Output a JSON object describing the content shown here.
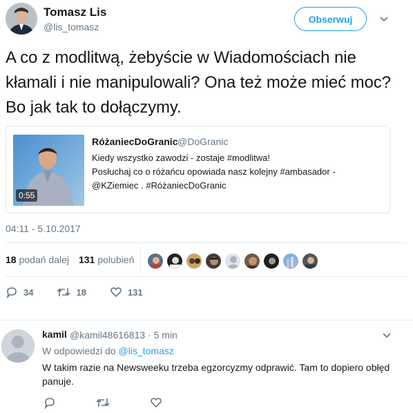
{
  "author": {
    "name": "Tomasz Lis",
    "handle": "@lis_tomasz",
    "follow_label": "Obserwuj"
  },
  "tweet": {
    "text": "A co z modlitwą, żebyście w Wiadomościach nie kłamali i nie manipulowali? Ona też może mieć moc? Bo jak tak to dołączymy.",
    "timestamp": "04:11 - 5.10.2017"
  },
  "quote": {
    "name": "RóżaniecDoGranic",
    "handle": "@DoGranic",
    "text_line1": "Kiedy wszystko zawodzi - zostaje #modlitwa!",
    "text_line2": "Posłuchaj co o różańcu opowiada nasz kolejny #ambasador -",
    "text_line3": "@KZiemiec . #RóżaniecDoGranic",
    "video_duration": "0:55"
  },
  "stats": {
    "retweets_count": "18",
    "retweets_label": "podań dalej",
    "likes_count": "131",
    "likes_label": "polubień"
  },
  "actions": {
    "replies": "34",
    "retweets": "18",
    "likes": "131"
  },
  "reply": {
    "name": "kamil",
    "handle": "@kamil48616813 · 5 min",
    "reply_to_prefix": "W odpowiedzi do",
    "reply_to_handle": "@lis_tomasz",
    "text": "W takim razie na Newsweeku trzeba egzorcyzmy odprawić. Tam to dopiero obłęd panuje."
  },
  "colors": {
    "accent": "#1da1f2",
    "muted": "#657786",
    "text": "#14171a",
    "border": "#e1e8ed"
  },
  "icons": [
    "caret-down-icon",
    "reply-icon",
    "retweet-icon",
    "heart-icon"
  ]
}
